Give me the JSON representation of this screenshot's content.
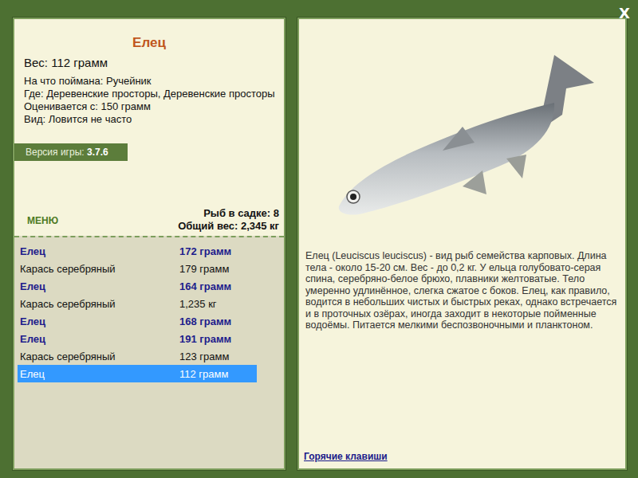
{
  "window": {
    "close": "X"
  },
  "fish": {
    "name": "Елец",
    "weight": "Вес: 112 грамм",
    "details": [
      "На что поймана: Ручейник",
      "Где: Деревенские просторы, Деревенские просторы",
      "Оценивается с: 150 грамм",
      "Вид: Ловится не часто"
    ]
  },
  "version": {
    "label": "Версия игры:",
    "value": "3.7.6"
  },
  "menu": "МЕНЮ",
  "keepnet": {
    "count": "Рыб в садке: 8",
    "total": "Общий вес: 2,345 кг"
  },
  "catch": [
    {
      "name": "Елец",
      "weight": "172 грамм",
      "kind": "featured",
      "selected": false
    },
    {
      "name": "Карась серебряный",
      "weight": "179 грамм",
      "kind": "plain",
      "selected": false
    },
    {
      "name": "Елец",
      "weight": "164 грамм",
      "kind": "featured",
      "selected": false
    },
    {
      "name": "Карась серебряный",
      "weight": "1,235 кг",
      "kind": "plain",
      "selected": false
    },
    {
      "name": "Елец",
      "weight": "168 грамм",
      "kind": "featured",
      "selected": false
    },
    {
      "name": "Елец",
      "weight": "191 грамм",
      "kind": "featured",
      "selected": false
    },
    {
      "name": "Карась серебряный",
      "weight": "123 грамм",
      "kind": "plain",
      "selected": false
    },
    {
      "name": "Елец",
      "weight": "112 грамм",
      "kind": "featured",
      "selected": true
    }
  ],
  "description": "Елец (Leuciscus leuciscus) - вид рыб семейства карповых. Длина тела - около 15-20 см. Вес - до 0,2 кг. У ельца голубовато-серая спина, серебряно-белое брюхо, плавники желтоватые. Тело умеренно удлинённое, слегка сжатое с боков. Елец, как правило, водится в небольших чистых и быстрых реках, однако встречается и в проточных озёрах, иногда заходит в некоторые пойменные водоёмы. Питается мелкими беспозвоночными и планктоном.",
  "hotkeys": "Горячие клавиши"
}
